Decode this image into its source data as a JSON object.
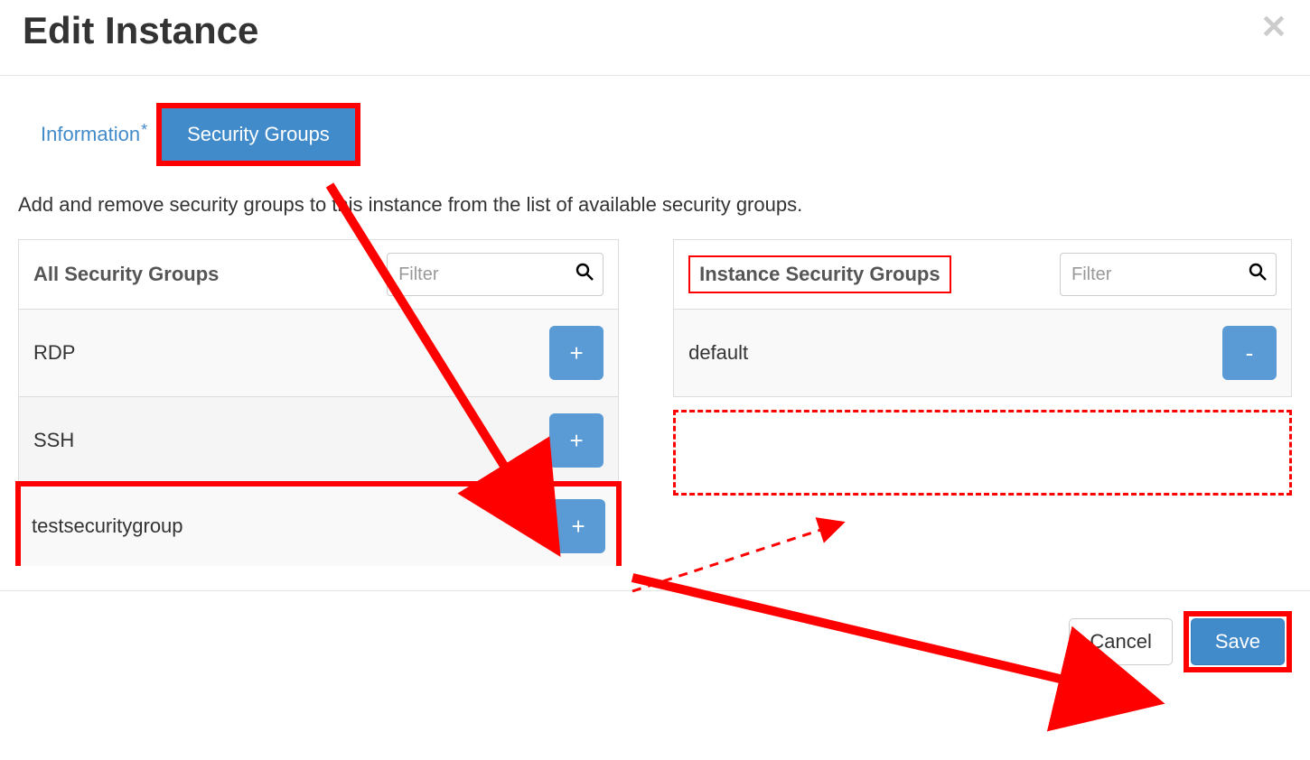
{
  "modal": {
    "title": "Edit Instance",
    "close": "✕"
  },
  "tabs": {
    "information": "Information",
    "asterisk": "*",
    "security_groups": "Security Groups"
  },
  "description": "Add and remove security groups to this instance from the list of available security groups.",
  "left_panel": {
    "title": "All Security Groups",
    "filter_placeholder": "Filter",
    "rows": [
      {
        "name": "RDP",
        "action": "+"
      },
      {
        "name": "SSH",
        "action": "+"
      },
      {
        "name": "testsecuritygroup",
        "action": "+"
      }
    ]
  },
  "right_panel": {
    "title": "Instance Security Groups",
    "filter_placeholder": "Filter",
    "rows": [
      {
        "name": "default",
        "action": "-"
      }
    ]
  },
  "footer": {
    "cancel": "Cancel",
    "save": "Save"
  }
}
